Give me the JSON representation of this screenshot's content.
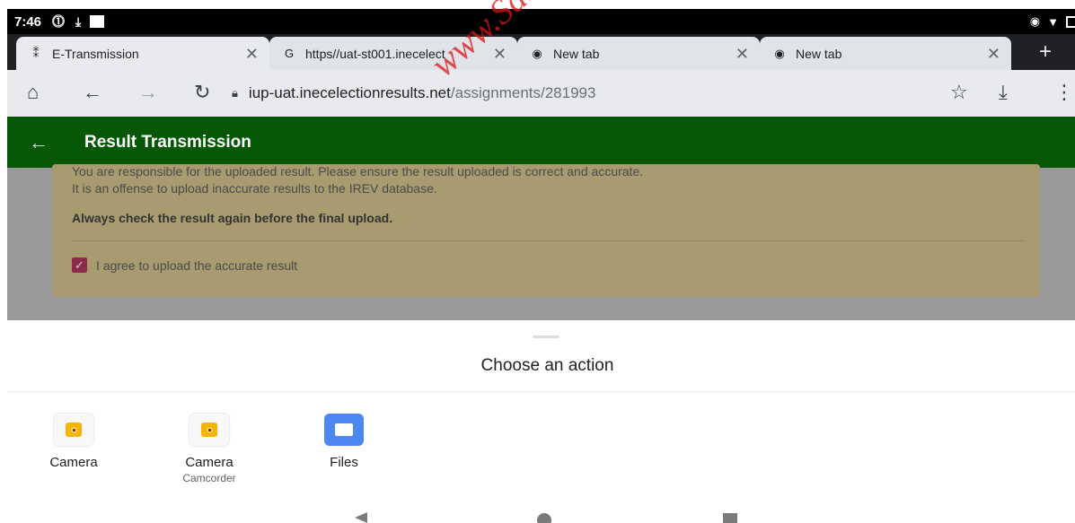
{
  "status_bar": {
    "time": "7:46"
  },
  "tabs": [
    {
      "title": "E-Transmission",
      "favicon": "⁑",
      "active": true
    },
    {
      "title": "https//uat-st001.inecelect",
      "favicon": "G",
      "active": false
    },
    {
      "title": "New tab",
      "favicon": "◉",
      "active": false
    },
    {
      "title": "New tab",
      "favicon": "◉",
      "active": false
    }
  ],
  "toolbar": {
    "url_host": "iup-uat.inecelectionresults.net",
    "url_path": "/assignments/281993"
  },
  "app_header": {
    "title": "Result Transmission"
  },
  "notice": {
    "line1": "You are responsible for the uploaded result. Please ensure the result uploaded is correct and accurate.",
    "line2": "It is an offense to upload inaccurate results to the IREV database.",
    "warning": "Always check the result again before the final upload.",
    "agree_label": "I agree to upload the accurate result",
    "agree_checked": true
  },
  "sheet": {
    "title": "Choose an action",
    "actions": [
      {
        "label": "Camera",
        "sub": "",
        "icon": "camera-icon"
      },
      {
        "label": "Camera",
        "sub": "Camcorder",
        "icon": "camcorder-icon"
      },
      {
        "label": "Files",
        "sub": "",
        "icon": "files-icon"
      }
    ]
  },
  "watermark": "www.Sab"
}
